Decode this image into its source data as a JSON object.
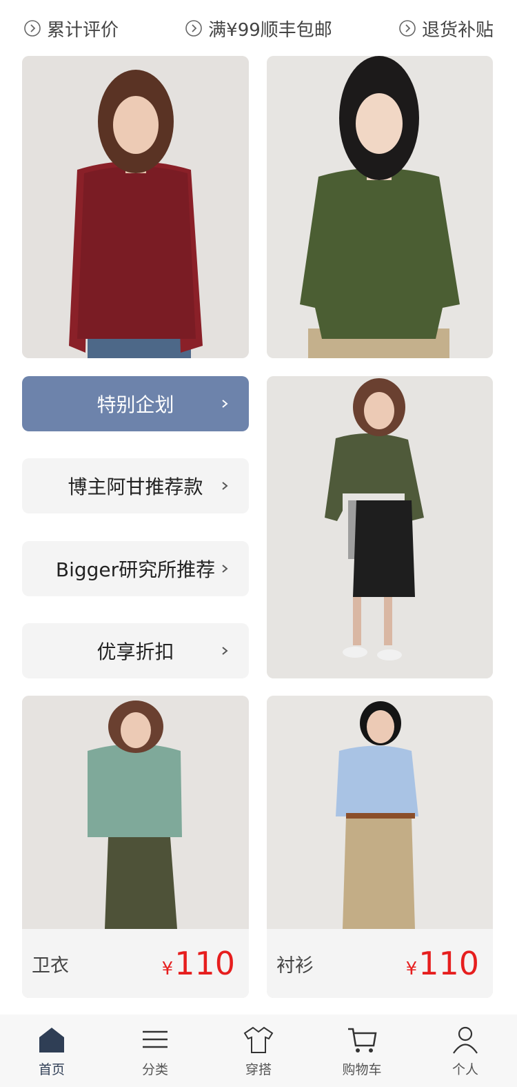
{
  "promos": [
    {
      "icon": "chevron-circle-icon",
      "label": "累计评价"
    },
    {
      "icon": "chevron-circle-icon",
      "label": "满¥99顺丰包邮"
    },
    {
      "icon": "chevron-circle-icon",
      "label": "退货补贴"
    }
  ],
  "menu": [
    {
      "label": "特别企划",
      "style": "primary"
    },
    {
      "label": "博主阿甘推荐款",
      "style": "default"
    },
    {
      "label": "Bigger研究所推荐",
      "style": "default"
    },
    {
      "label": "优享折扣",
      "style": "default"
    }
  ],
  "products": [
    {
      "name": "卫衣",
      "currency": "¥",
      "price": "110"
    },
    {
      "name": "衬衫",
      "currency": "¥",
      "price": "110"
    }
  ],
  "tabs": [
    {
      "label": "首页",
      "icon": "home-icon",
      "active": true
    },
    {
      "label": "分类",
      "icon": "menu-icon",
      "active": false
    },
    {
      "label": "穿搭",
      "icon": "shirt-icon",
      "active": false
    },
    {
      "label": "购物车",
      "icon": "cart-icon",
      "active": false
    },
    {
      "label": "个人",
      "icon": "person-icon",
      "active": false
    }
  ],
  "colors": {
    "accent": "#6d83ab",
    "price": "#e61e1e",
    "tab_active": "#2f3e55"
  }
}
